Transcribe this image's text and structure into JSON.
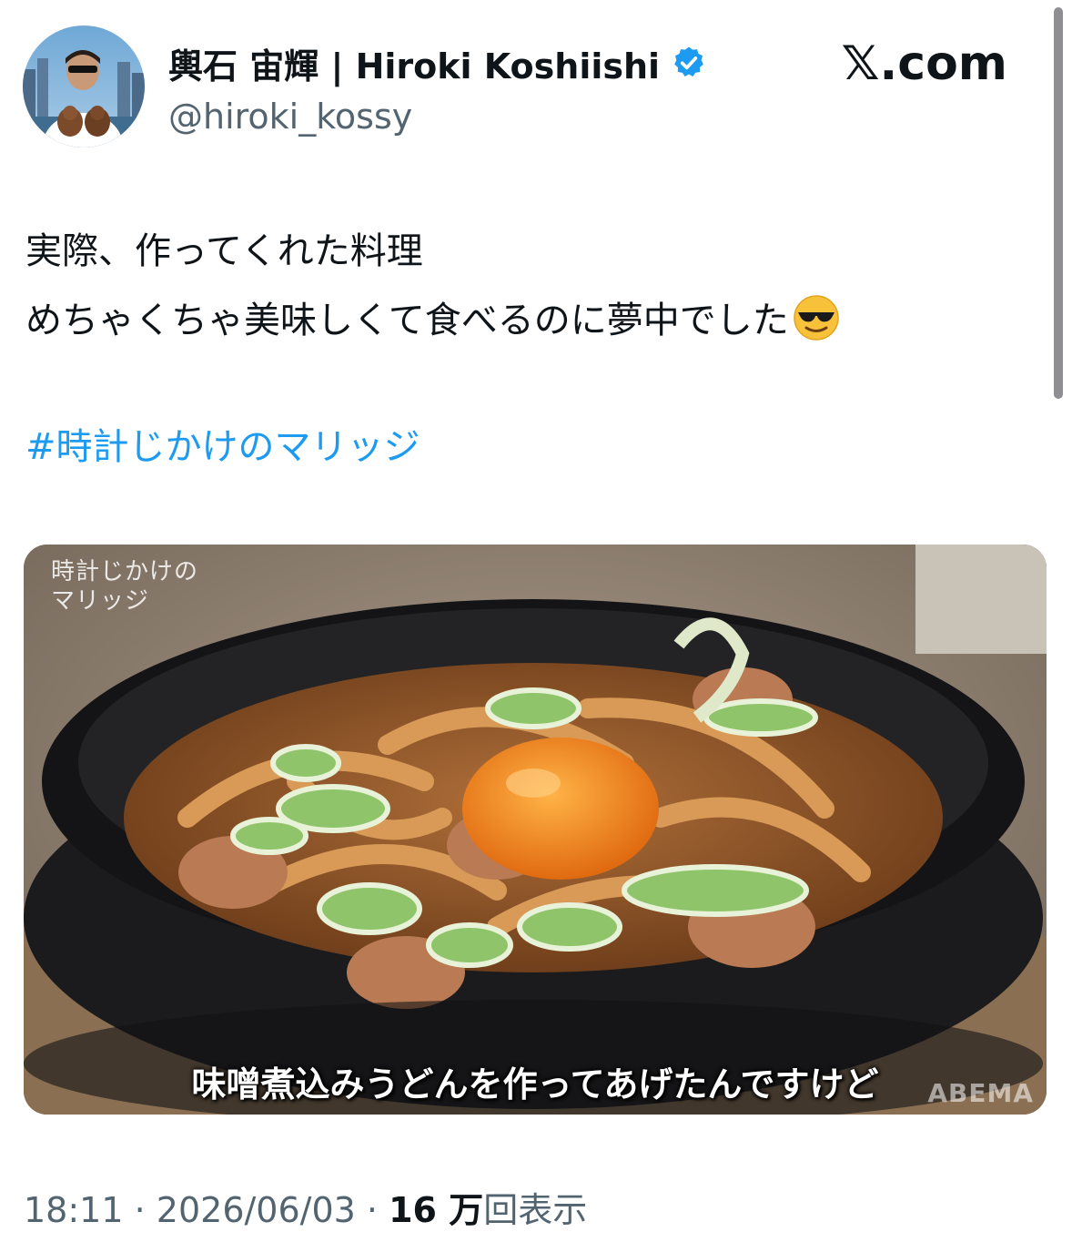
{
  "header": {
    "display_name": "輿石 宙輝 | Hiroki Koshiishi",
    "handle": "@hiroki_kossy",
    "site_logo": "𝕏.com",
    "verified_color": "#1d9bf0"
  },
  "tweet": {
    "lines": [
      "実際、作ってくれた料理",
      "めちゃくちゃ美味しくて食べるのに夢中でした"
    ],
    "emoji": "smiling-face-with-sunglasses",
    "hashtag": "#時計じかけのマリッジ"
  },
  "media": {
    "watermark_title_line1": "時計じかけの",
    "watermark_title_line2": "マリッジ",
    "subtitle": "味噌煮込みうどんを作ってあげたんですけど",
    "broadcaster": "ABEMA"
  },
  "meta": {
    "time": "18:11",
    "separator": "·",
    "date": "2026/06/03",
    "views_count": "16 万",
    "views_label": "回表示"
  },
  "colors": {
    "text": "#0f1419",
    "secondary": "#536471",
    "link": "#1d9bf0"
  }
}
